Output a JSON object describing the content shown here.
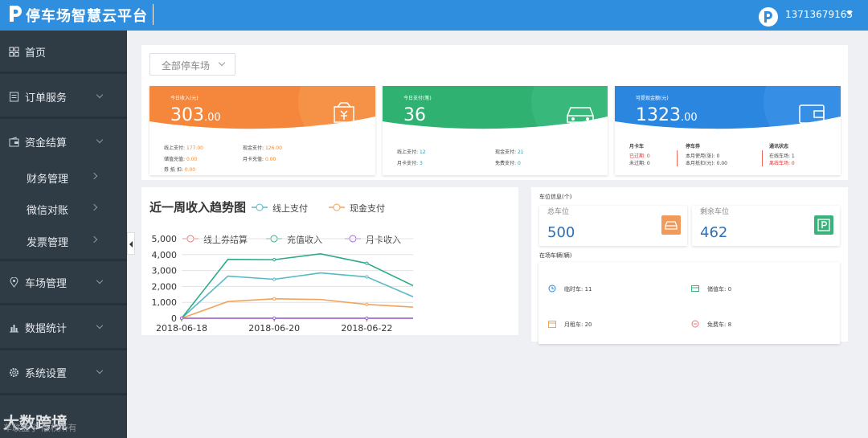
{
  "header": {
    "title": "停车场智慧云平台",
    "user": "13713679165"
  },
  "sidebar": {
    "items": [
      {
        "label": "首页"
      },
      {
        "label": "订单服务"
      },
      {
        "label": "资金结算"
      },
      {
        "label": "车场管理"
      },
      {
        "label": "数据统计"
      },
      {
        "label": "系统设置"
      }
    ],
    "subitems": [
      {
        "label": "财务管理"
      },
      {
        "label": "微信对账"
      },
      {
        "label": "发票管理"
      }
    ]
  },
  "watermark": {
    "main": "大数跨境",
    "faint": "车联盒子 版权所有"
  },
  "filter": {
    "selected": "全部停车场"
  },
  "cards": {
    "income": {
      "title": "今日收入(元)",
      "value_int": "303",
      "value_dec": ".00",
      "rows": [
        {
          "label": "线上支付:",
          "value": "177.00"
        },
        {
          "label": "现金支付:",
          "value": "126.00"
        },
        {
          "label": "储值充值:",
          "value": "0.00"
        },
        {
          "label": "月卡充值:",
          "value": "0.00"
        },
        {
          "label": "券 抵 扣:",
          "value": "0.00"
        }
      ]
    },
    "payments": {
      "title": "今日支付(笔)",
      "value": "36",
      "rows": [
        {
          "label": "线上支付:",
          "value": "12"
        },
        {
          "label": "现金支付:",
          "value": "21"
        },
        {
          "label": "月卡支付:",
          "value": "3"
        },
        {
          "label": "免费支付:",
          "value": "0"
        }
      ]
    },
    "balance": {
      "title": "可提现金额(元)",
      "value_int": "1323",
      "value_dec": ".00",
      "col1_title": "月卡车",
      "col1": [
        "已过期: 0",
        "未过期: 0"
      ],
      "col2_title": "停车券",
      "col2": [
        "本月使用(张): 0",
        "本月抵扣(元): 0.00"
      ],
      "col3_title": "通讯状态",
      "col3": [
        "在线车场: 1",
        "离线车场: 0"
      ]
    }
  },
  "chart_data": {
    "type": "line",
    "title": "近一周收入趋势图",
    "x": [
      "2018-06-18",
      "2018-06-19",
      "2018-06-20",
      "2018-06-21",
      "2018-06-22",
      "2018-06-23"
    ],
    "x_ticks": [
      "2018-06-18",
      "2018-06-20",
      "2018-06-22"
    ],
    "y_ticks": [
      "0",
      "1,000",
      "2,000",
      "3,000",
      "4,000",
      "5,000"
    ],
    "ylim": [
      0,
      5000
    ],
    "series": [
      {
        "name": "线上支付",
        "color": "#5ab8c8",
        "values": [
          0,
          2650,
          2450,
          2850,
          2600,
          1350
        ]
      },
      {
        "name": "现金支付",
        "color": "#f0a45c",
        "values": [
          0,
          1050,
          1220,
          1180,
          870,
          700
        ]
      },
      {
        "name": "线上券结算",
        "color": "#e87878",
        "values": [
          0,
          0,
          0,
          0,
          0,
          0
        ]
      },
      {
        "name": "充值收入",
        "color": "#2eaa8a",
        "values": [
          0,
          3700,
          3680,
          4050,
          3450,
          2050
        ]
      },
      {
        "name": "月卡收入",
        "color": "#9a6ad8",
        "values": [
          0,
          0,
          0,
          0,
          0,
          0
        ]
      }
    ],
    "legend_row1": [
      "线上支付",
      "现金支付"
    ],
    "legend_row2": [
      "线上券结算",
      "充值收入",
      "月卡收入"
    ],
    "grid": true
  },
  "parking": {
    "title": "车位信息(个)",
    "total_label": "总车位",
    "total_value": "500",
    "remain_label": "剩余车位",
    "remain_value": "462",
    "vehicles_title": "在场车辆(辆)",
    "vehicles": [
      {
        "label": "临时车:",
        "value": "11"
      },
      {
        "label": "储值车:",
        "value": "0"
      },
      {
        "label": "月租车:",
        "value": "20"
      },
      {
        "label": "免费车:",
        "value": "8"
      }
    ]
  }
}
